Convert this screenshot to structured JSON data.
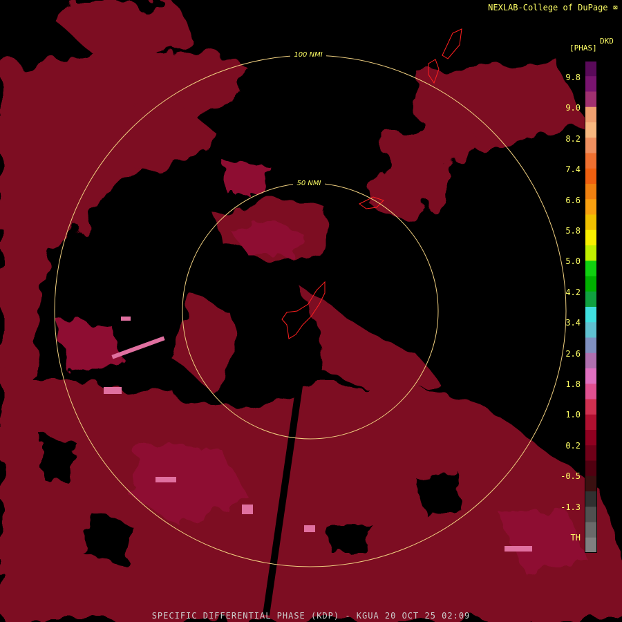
{
  "header": {
    "credit": "NEXLAB-College of DuPage"
  },
  "footer": {
    "title": "SPECIFIC DIFFERENTIAL PHASE (KDP) - KGUA 20 OCT 25 02:09"
  },
  "rings": [
    {
      "label": "100 NMI"
    },
    {
      "label": "50 NMI"
    }
  ],
  "legend": {
    "unit_line1": "DKD",
    "unit_line2": "[PHAS]",
    "ticks": [
      "9.8",
      "9.0",
      "8.2",
      "7.4",
      "6.6",
      "5.8",
      "5.0",
      "4.2",
      "3.4",
      "2.6",
      "1.8",
      "1.0",
      "0.2",
      "-0.5",
      "-1.3",
      "TH"
    ],
    "colors": [
      "#5a0a5a",
      "#7a1470",
      "#a03070",
      "#f0a070",
      "#f8b880",
      "#f09060",
      "#f07030",
      "#f06010",
      "#f08010",
      "#f8a010",
      "#f0c000",
      "#f8f000",
      "#c0f000",
      "#10d010",
      "#00b000",
      "#10a040",
      "#40e0e0",
      "#60c0d0",
      "#8090c0",
      "#b070b0",
      "#e070c0",
      "#e05090",
      "#d03050",
      "#b01030",
      "#900020",
      "#700018",
      "#500010",
      "#3a1010",
      "#303030",
      "#505050",
      "#6a6a6a",
      "#808080"
    ]
  }
}
